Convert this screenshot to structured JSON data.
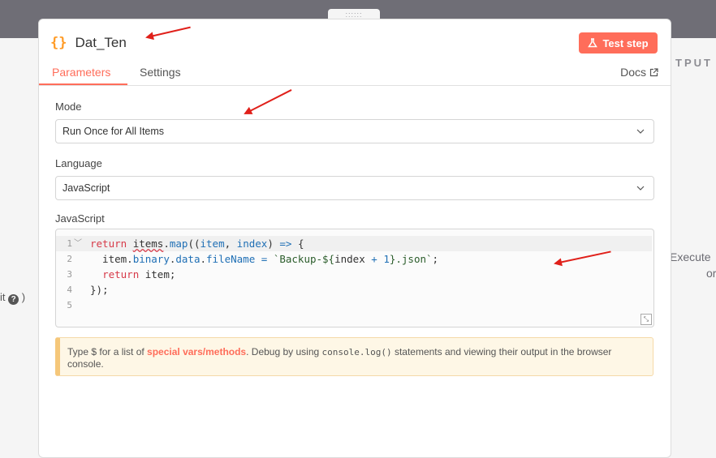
{
  "background": {
    "output_label": "TPUT",
    "execute_text": "Execute",
    "or_text": "or",
    "hint_text": "it",
    "hint_close": ")"
  },
  "node": {
    "title": "Dat_Ten",
    "test_button_label": "Test step",
    "icon": "braces-icon"
  },
  "tabs": [
    {
      "label": "Parameters",
      "active": true
    },
    {
      "label": "Settings",
      "active": false
    }
  ],
  "docs_label": "Docs",
  "fields": {
    "mode": {
      "label": "Mode",
      "value": "Run Once for All Items"
    },
    "language": {
      "label": "Language",
      "value": "JavaScript"
    },
    "code": {
      "label": "JavaScript"
    }
  },
  "code_lines": [
    {
      "n": "1"
    },
    {
      "n": "2"
    },
    {
      "n": "3"
    },
    {
      "n": "4"
    },
    {
      "n": "5"
    }
  ],
  "notice": {
    "prefix": "Type $ for a list of ",
    "link": "special vars/methods",
    "middle": ". Debug by using ",
    "code": "console.log()",
    "suffix": " statements and viewing their output in the browser console."
  },
  "colors": {
    "accent": "#ff6d5a",
    "braces": "#ff9b26",
    "arrows": "#e0201a"
  }
}
